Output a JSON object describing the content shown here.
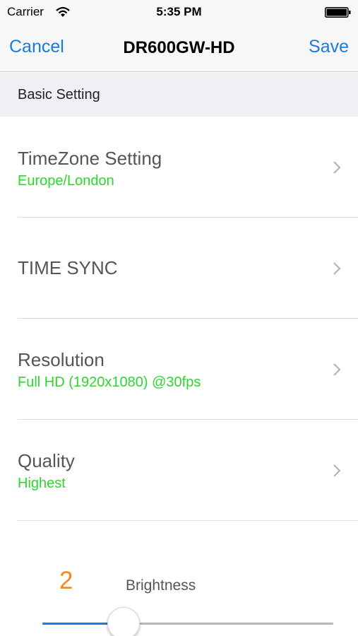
{
  "status_bar": {
    "carrier": "Carrier",
    "time": "5:35 PM"
  },
  "nav": {
    "cancel_label": "Cancel",
    "title": "DR600GW-HD",
    "save_label": "Save"
  },
  "section": {
    "title": "Basic Setting"
  },
  "rows": [
    {
      "title": "TimeZone Setting",
      "value": "Europe/London"
    },
    {
      "title": "TIME SYNC",
      "value": ""
    },
    {
      "title": "Resolution",
      "value": "Full HD (1920x1080) @30fps"
    },
    {
      "title": "Quality",
      "value": "Highest"
    }
  ],
  "brightness": {
    "value": "2",
    "label": "Brightness",
    "level_fraction": 0.28
  },
  "colors": {
    "accent": "#1a7ae0",
    "value_text": "#2ed52e",
    "brightness_value": "#f08a1f"
  },
  "icons": {
    "wifi": "wifi-icon",
    "battery": "battery-icon",
    "chevron": "chevron-right-icon"
  }
}
